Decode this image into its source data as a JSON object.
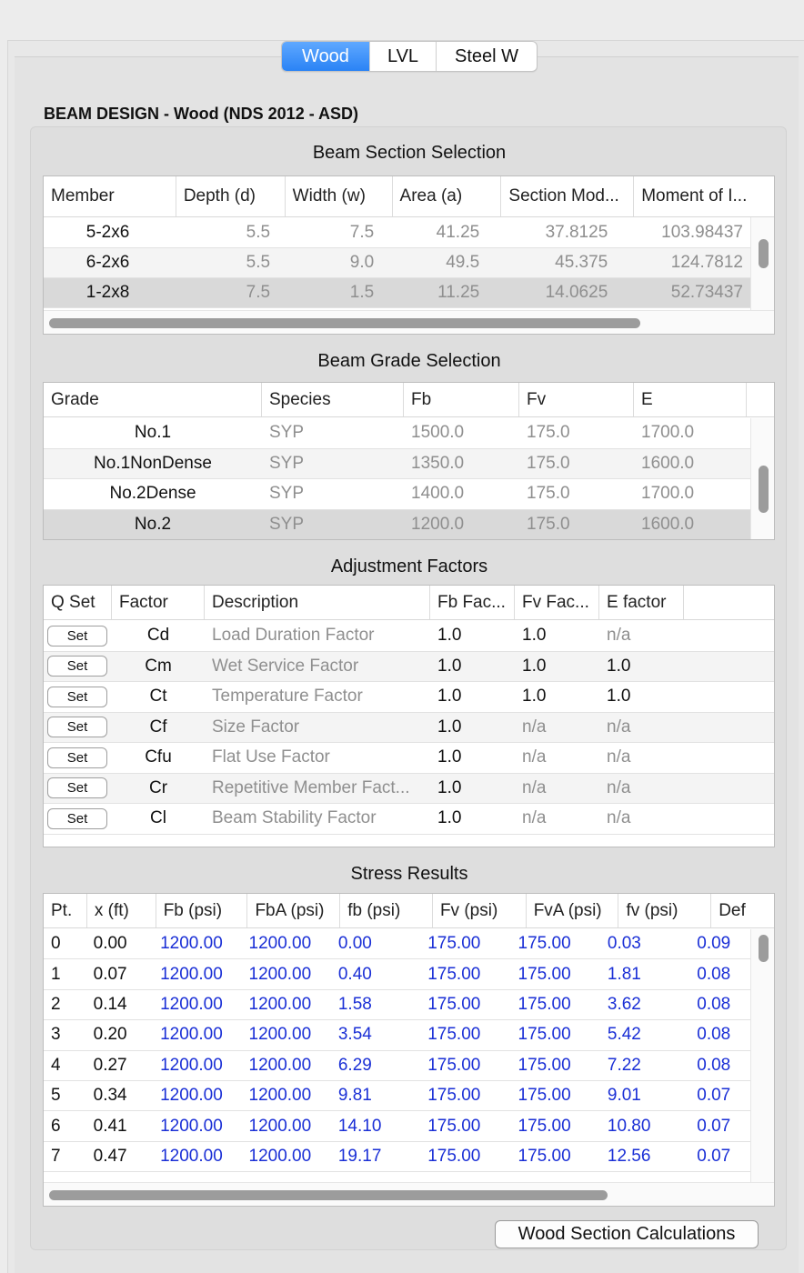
{
  "tabs": [
    "Wood",
    "LVL",
    "Steel W"
  ],
  "active_tab": "Wood",
  "page_title": "BEAM DESIGN - Wood (NDS 2012 - ASD)",
  "section_table": {
    "title": "Beam Section Selection",
    "columns": [
      "Member",
      "Depth (d)",
      "Width (w)",
      "Area (a)",
      "Section Mod...",
      "Moment of I..."
    ],
    "rows": [
      [
        "5-2x6",
        "5.5",
        "7.5",
        "41.25",
        "37.8125",
        "103.98437"
      ],
      [
        "6-2x6",
        "5.5",
        "9.0",
        "49.5",
        "45.375",
        "124.7812"
      ],
      [
        "1-2x8",
        "7.5",
        "1.5",
        "11.25",
        "14.0625",
        "52.73437"
      ]
    ],
    "selected_row": 2
  },
  "grade_table": {
    "title": "Beam Grade Selection",
    "columns": [
      "Grade",
      "Species",
      "Fb",
      "Fv",
      "E"
    ],
    "rows": [
      [
        "No.1",
        "SYP",
        "1500.0",
        "175.0",
        "1700.0"
      ],
      [
        "No.1NonDense",
        "SYP",
        "1350.0",
        "175.0",
        "1600.0"
      ],
      [
        "No.2Dense",
        "SYP",
        "1400.0",
        "175.0",
        "1700.0"
      ],
      [
        "No.2",
        "SYP",
        "1200.0",
        "175.0",
        "1600.0"
      ]
    ],
    "selected_row": 3
  },
  "factors_table": {
    "title": "Adjustment Factors",
    "columns": [
      "Q Set",
      "Factor",
      "Description",
      "Fb Fac...",
      "Fv Fac...",
      "E factor"
    ],
    "set_label": "Set",
    "rows": [
      [
        "Cd",
        "Load Duration Factor",
        "1.0",
        "1.0",
        "n/a"
      ],
      [
        "Cm",
        "Wet Service Factor",
        "1.0",
        "1.0",
        "1.0"
      ],
      [
        "Ct",
        "Temperature Factor",
        "1.0",
        "1.0",
        "1.0"
      ],
      [
        "Cf",
        "Size Factor",
        "1.0",
        "n/a",
        "n/a"
      ],
      [
        "Cfu",
        "Flat Use Factor",
        "1.0",
        "n/a",
        "n/a"
      ],
      [
        "Cr",
        "Repetitive Member Fact...",
        "1.0",
        "n/a",
        "n/a"
      ],
      [
        "Cl",
        "Beam Stability Factor",
        "1.0",
        "n/a",
        "n/a"
      ]
    ]
  },
  "stress_table": {
    "title": "Stress Results",
    "columns": [
      "Pt.",
      "x (ft)",
      "Fb (psi)",
      "FbA (psi)",
      "fb (psi)",
      "Fv (psi)",
      "FvA (psi)",
      "fv (psi)",
      "Def"
    ],
    "rows": [
      [
        "0",
        "0.00",
        "1200.00",
        "1200.00",
        "0.00",
        "175.00",
        "175.00",
        "0.03",
        "0.09"
      ],
      [
        "1",
        "0.07",
        "1200.00",
        "1200.00",
        "0.40",
        "175.00",
        "175.00",
        "1.81",
        "0.08"
      ],
      [
        "2",
        "0.14",
        "1200.00",
        "1200.00",
        "1.58",
        "175.00",
        "175.00",
        "3.62",
        "0.08"
      ],
      [
        "3",
        "0.20",
        "1200.00",
        "1200.00",
        "3.54",
        "175.00",
        "175.00",
        "5.42",
        "0.08"
      ],
      [
        "4",
        "0.27",
        "1200.00",
        "1200.00",
        "6.29",
        "175.00",
        "175.00",
        "7.22",
        "0.08"
      ],
      [
        "5",
        "0.34",
        "1200.00",
        "1200.00",
        "9.81",
        "175.00",
        "175.00",
        "9.01",
        "0.07"
      ],
      [
        "6",
        "0.41",
        "1200.00",
        "1200.00",
        "14.10",
        "175.00",
        "175.00",
        "10.80",
        "0.07"
      ],
      [
        "7",
        "0.47",
        "1200.00",
        "1200.00",
        "19.17",
        "175.00",
        "175.00",
        "12.56",
        "0.07"
      ]
    ]
  },
  "calc_button": "Wood Section Calculations",
  "colors": {
    "accent": "#2a83f5",
    "value_blue": "#1a2fd6",
    "muted_gray": "#8f8f8f"
  }
}
